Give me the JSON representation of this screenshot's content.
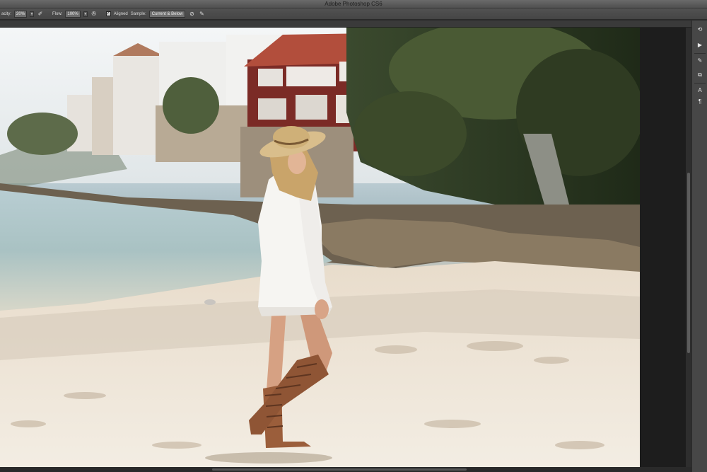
{
  "window": {
    "title": "Adobe Photoshop CS6"
  },
  "options_bar": {
    "opacity_label": "acity:",
    "opacity_value": "20%",
    "flow_label": "Flow:",
    "flow_value": "100%",
    "aligned_label": "Aligned",
    "sample_label": "Sample:",
    "sample_value": "Current & Below",
    "icons": [
      "pressure-opacity-icon",
      "airbrush-icon",
      "ignore-adjustment-icon",
      "pressure-size-icon"
    ]
  },
  "right_dock": {
    "buttons": [
      {
        "icon": "history-icon",
        "glyph": "⟲"
      },
      {
        "icon": "actions-play-icon",
        "glyph": "▶"
      },
      {
        "icon": "brush-preset-icon",
        "glyph": "✎"
      },
      {
        "icon": "clone-source-icon",
        "glyph": "⧉"
      },
      {
        "icon": "character-icon",
        "glyph": "A"
      },
      {
        "icon": "paragraph-icon",
        "glyph": "¶"
      }
    ]
  },
  "colors": {
    "ui_dark": "#2b2b2b",
    "ui_mid": "#474747",
    "titlebar": "#5c5c5c"
  }
}
